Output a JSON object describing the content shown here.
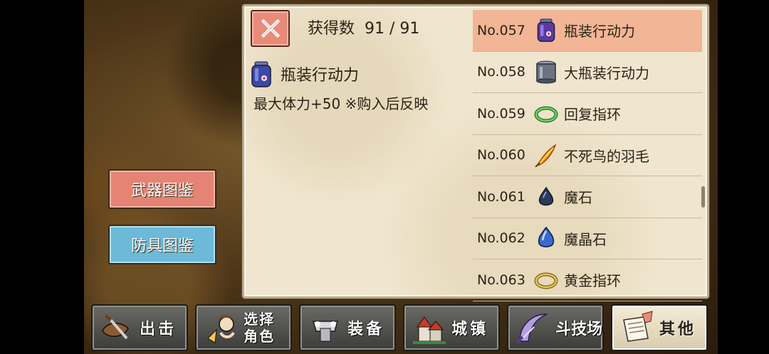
{
  "header": {
    "count_label": "获得数",
    "count_value": "91 / 91"
  },
  "detail": {
    "icon": "potion-jar-icon",
    "name": "瓶装行动力",
    "description": "最大体力+50 ※购入后反映"
  },
  "items": [
    {
      "no": "No.057",
      "name": "瓶装行动力",
      "icon": "potion-jar-icon",
      "selected": true
    },
    {
      "no": "No.058",
      "name": "大瓶装行动力",
      "icon": "large-jar-icon",
      "selected": false
    },
    {
      "no": "No.059",
      "name": "回复指环",
      "icon": "green-ring-icon",
      "selected": false
    },
    {
      "no": "No.060",
      "name": "不死鸟的羽毛",
      "icon": "phoenix-feather-icon",
      "selected": false
    },
    {
      "no": "No.061",
      "name": "魔石",
      "icon": "magic-stone-icon",
      "selected": false
    },
    {
      "no": "No.062",
      "name": "魔晶石",
      "icon": "magic-crystal-icon",
      "selected": false
    },
    {
      "no": "No.063",
      "name": "黄金指环",
      "icon": "gold-ring-icon",
      "selected": false
    }
  ],
  "side_buttons": {
    "weapon": "武器图鉴",
    "armor": "防具图鉴"
  },
  "nav": [
    {
      "label": "出击",
      "icon": "sortie-icon"
    },
    {
      "label": "选择角色",
      "line1": "选择",
      "line2": "角色",
      "icon": "character-select-icon"
    },
    {
      "label": "装备",
      "icon": "equipment-icon"
    },
    {
      "label": "城镇",
      "icon": "town-icon"
    },
    {
      "label": "斗技场",
      "icon": "arena-icon"
    },
    {
      "label": "其他",
      "icon": "other-icon",
      "active": true
    }
  ],
  "colors": {
    "panel_bg": "#f0e6cf",
    "selected_row": "#f2b596",
    "weapon_button": "#e58474",
    "armor_button": "#6cb9d8"
  }
}
